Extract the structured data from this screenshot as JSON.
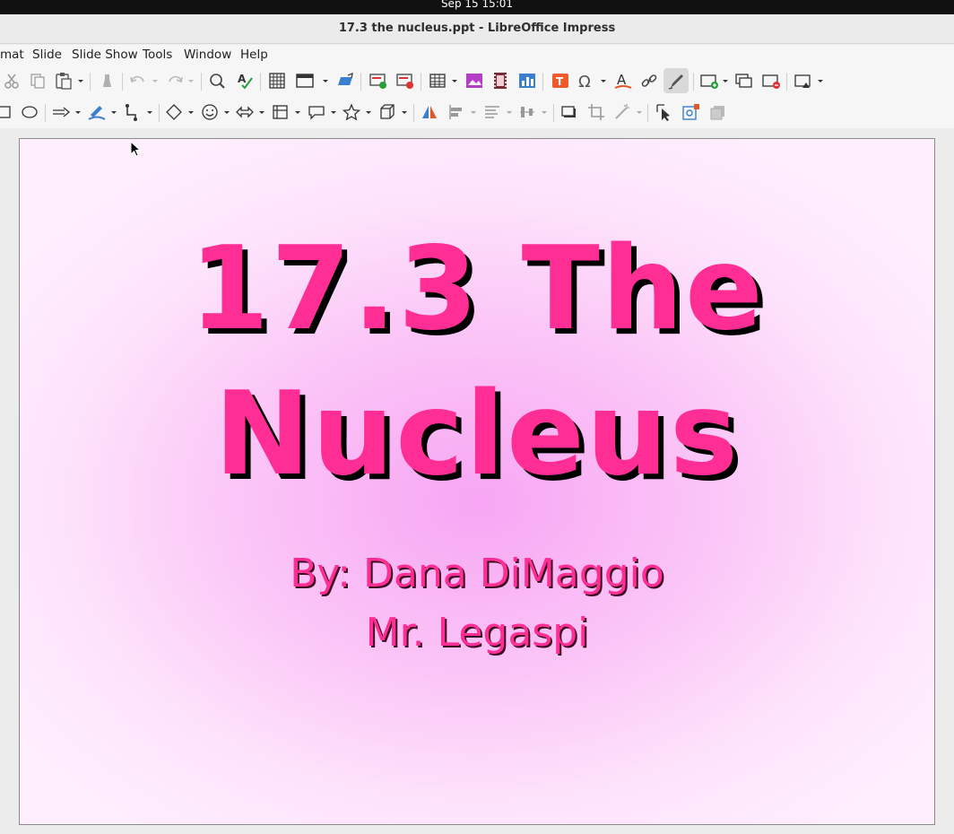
{
  "system": {
    "clock": "Sep 15  15:01"
  },
  "window": {
    "title": "17.3 the nucleus.ppt - LibreOffice Impress"
  },
  "menu": {
    "items": [
      "mat",
      "Slide",
      "Slide Show",
      "Tools",
      "Window",
      "Help"
    ]
  },
  "slide": {
    "title_line1": "17.3 The",
    "title_line2": "Nucleus",
    "subtitle_line1": "By: Dana DiMaggio",
    "subtitle_line2": "Mr. Legaspi"
  },
  "colors": {
    "title_pink": "#ff2e95",
    "slide_bg_center": "#f7a6f3",
    "slide_bg_edge": "#ffeefe"
  },
  "icons": {
    "toolbar1": [
      "cut-icon",
      "copy-icon",
      "paste-icon",
      "clone-formatting-icon",
      "undo-icon",
      "redo-icon",
      "find-replace-icon",
      "spelling-icon",
      "grid-icon",
      "display-views-icon",
      "master-slide-icon",
      "start-from-first-icon",
      "start-from-current-icon",
      "table-icon",
      "image-icon",
      "media-icon",
      "chart-icon",
      "textbox-icon",
      "special-character-icon",
      "fontwork-icon",
      "hyperlink-icon",
      "draw-function-icon",
      "new-slide-icon",
      "duplicate-slide-icon",
      "delete-slide-icon",
      "slide-layout-icon"
    ],
    "toolbar2": [
      "rectangle-icon",
      "ellipse-icon",
      "arrow-icon",
      "line-color-icon",
      "connector-icon",
      "basic-shapes-icon",
      "symbol-shapes-icon",
      "block-arrows-icon",
      "flowchart-icon",
      "callouts-icon",
      "stars-icon",
      "3d-objects-icon",
      "transformations-icon",
      "align-icon",
      "arrange-icon",
      "distribute-icon",
      "shadow-icon",
      "crop-icon",
      "filter-icon",
      "select-icon",
      "glue-points-icon",
      "extrusion-icon"
    ]
  }
}
